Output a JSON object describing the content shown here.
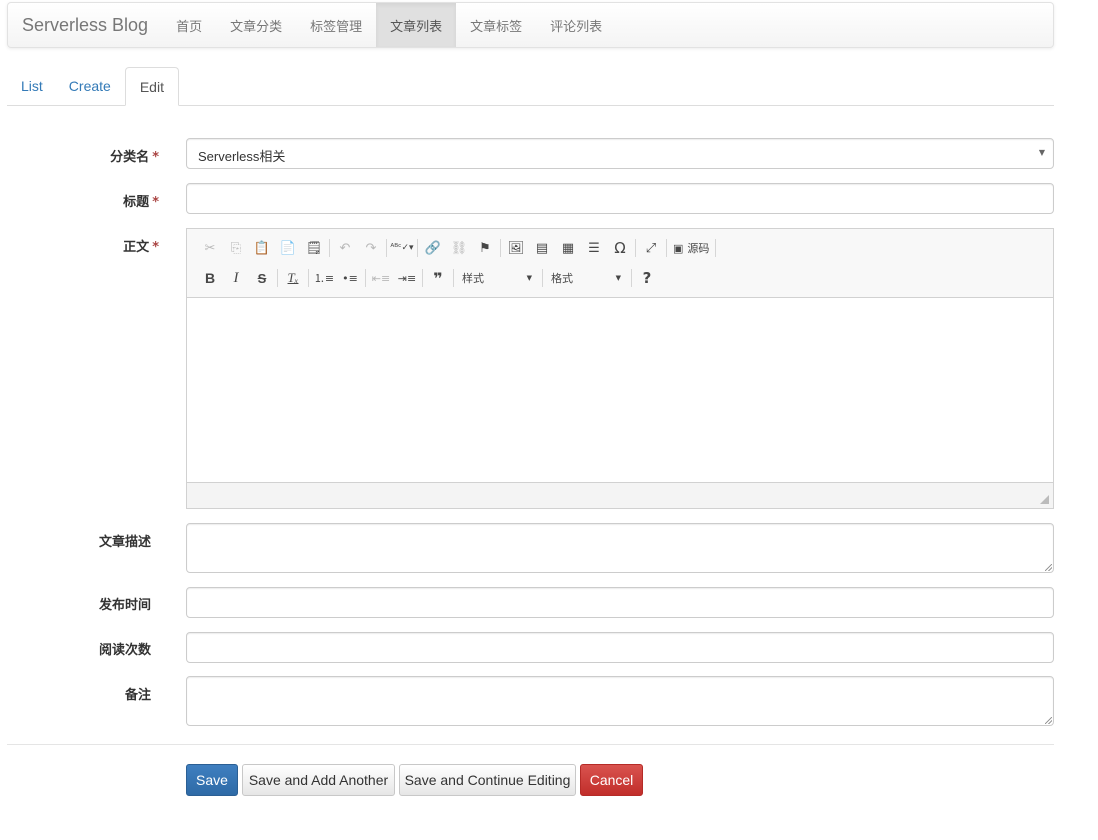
{
  "navbar": {
    "brand": "Serverless Blog",
    "items": [
      {
        "label": "首页",
        "active": false
      },
      {
        "label": "文章分类",
        "active": false
      },
      {
        "label": "标签管理",
        "active": false
      },
      {
        "label": "文章列表",
        "active": true
      },
      {
        "label": "文章标签",
        "active": false
      },
      {
        "label": "评论列表",
        "active": false
      }
    ]
  },
  "tabs": [
    {
      "label": "List",
      "active": false
    },
    {
      "label": "Create",
      "active": false
    },
    {
      "label": "Edit",
      "active": true
    }
  ],
  "form": {
    "category": {
      "label": "分类名",
      "required_mark": "*",
      "value": "Serverless相关"
    },
    "title": {
      "label": "标题",
      "required_mark": "*",
      "value": ""
    },
    "body": {
      "label": "正文",
      "required_mark": "*",
      "toolbar": {
        "source_label": "源码",
        "styles_combo": "样式",
        "format_combo": "格式"
      }
    },
    "description": {
      "label": "文章描述",
      "value": ""
    },
    "publish_time": {
      "label": "发布时间",
      "value": ""
    },
    "read_count": {
      "label": "阅读次数",
      "value": ""
    },
    "remark": {
      "label": "备注",
      "value": ""
    }
  },
  "buttons": {
    "save": "Save",
    "save_add": "Save and Add Another",
    "save_continue": "Save and Continue Editing",
    "cancel": "Cancel"
  },
  "colors": {
    "primary": "#337ab7",
    "danger": "#d9534f",
    "required": "#a94442"
  }
}
